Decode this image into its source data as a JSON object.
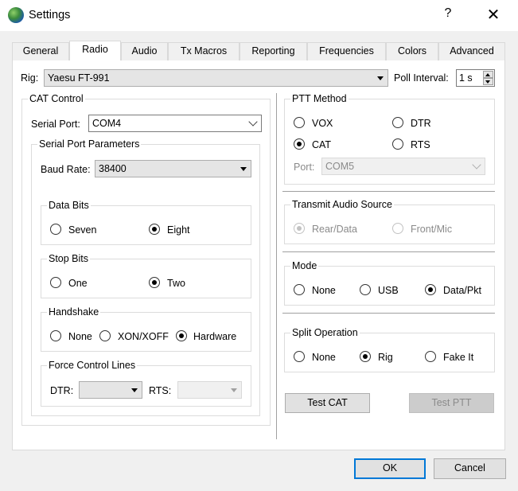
{
  "window": {
    "title": "Settings",
    "help": "?",
    "close": "✕"
  },
  "tabs": [
    {
      "label": "General"
    },
    {
      "label": "Radio"
    },
    {
      "label": "Audio"
    },
    {
      "label": "Tx Macros"
    },
    {
      "label": "Reporting"
    },
    {
      "label": "Frequencies"
    },
    {
      "label": "Colors"
    },
    {
      "label": "Advanced"
    }
  ],
  "active_tab": "Radio",
  "rig": {
    "label": "Rig:",
    "value": "Yaesu FT-991"
  },
  "poll": {
    "label": "Poll Interval:",
    "value": "1 s"
  },
  "cat": {
    "title": "CAT Control",
    "serial_port_label": "Serial Port:",
    "serial_port_value": "COM4",
    "params_title": "Serial Port Parameters",
    "baud_label": "Baud Rate:",
    "baud_value": "38400",
    "data_bits": {
      "title": "Data Bits",
      "seven": "Seven",
      "eight": "Eight",
      "selected": "Eight"
    },
    "stop_bits": {
      "title": "Stop Bits",
      "one": "One",
      "two": "Two",
      "selected": "Two"
    },
    "handshake": {
      "title": "Handshake",
      "none": "None",
      "xon": "XON/XOFF",
      "hardware": "Hardware",
      "selected": "Hardware"
    },
    "force": {
      "title": "Force Control Lines",
      "dtr": "DTR:",
      "rts": "RTS:",
      "dtr_value": "",
      "rts_value": ""
    }
  },
  "ptt": {
    "title": "PTT Method",
    "vox": "VOX",
    "dtr": "DTR",
    "cat": "CAT",
    "rts": "RTS",
    "selected": "CAT",
    "port_label": "Port:",
    "port_value": "COM5"
  },
  "tx_audio": {
    "title": "Transmit Audio Source",
    "rear": "Rear/Data",
    "front": "Front/Mic",
    "selected": "Rear/Data"
  },
  "mode": {
    "title": "Mode",
    "none": "None",
    "usb": "USB",
    "data": "Data/Pkt",
    "selected": "Data/Pkt"
  },
  "split": {
    "title": "Split Operation",
    "none": "None",
    "rig": "Rig",
    "fake": "Fake It",
    "selected": "Rig"
  },
  "buttons": {
    "test_cat": "Test CAT",
    "test_ptt": "Test PTT",
    "ok": "OK",
    "cancel": "Cancel"
  }
}
